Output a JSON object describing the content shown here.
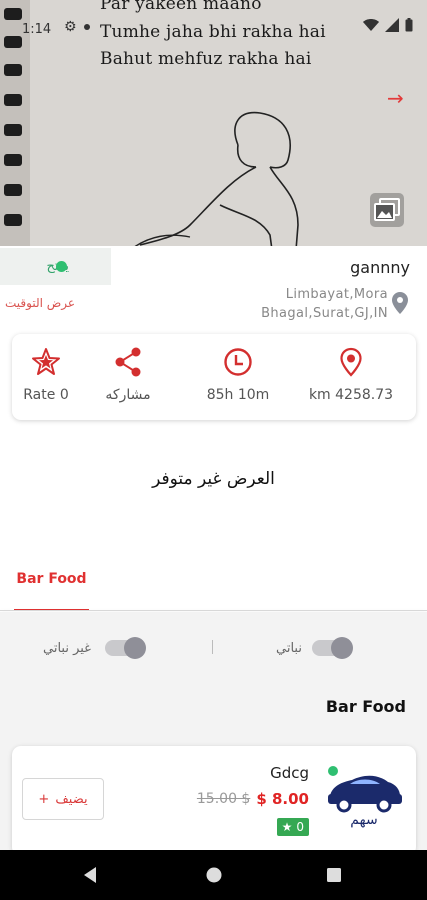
{
  "status_bar": {
    "time": "1:14"
  },
  "hero": {
    "lines": [
      "Par yakeen maano",
      "Tumhe jaha bhi rakha hai",
      "Bahut mehfuz rakha hai"
    ]
  },
  "store": {
    "open_label": "يفتح",
    "hours_link": "عرض التوقيت",
    "name": "gannny",
    "address": "Limbayat,Mora Bhagal,Surat,GJ,IN"
  },
  "stats": {
    "rate": "Rate 0",
    "share": "مشاركه",
    "time": "85h 10m",
    "distance": "km 4258.73"
  },
  "offer_unavailable": "العرض غير متوفر",
  "tabs": [
    {
      "label": "Bar Food"
    }
  ],
  "filters": {
    "veg_label": "نباتي",
    "nonveg_label": "غير نباتي"
  },
  "section_title": "Bar Food",
  "product": {
    "name": "Gdcg",
    "price_new": "$ 8.00",
    "price_old": "15.00 $",
    "rating": "0",
    "add_label": "يضيف",
    "logo_text": "سهم"
  },
  "colors": {
    "accent": "#e03131",
    "open_green": "#2fbf71",
    "rating_green": "#35a853"
  }
}
